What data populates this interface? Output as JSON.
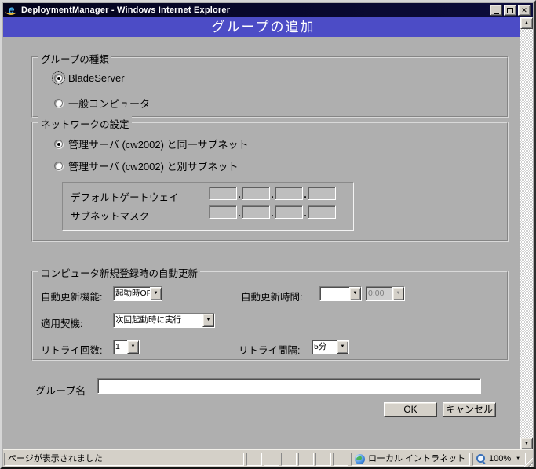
{
  "window": {
    "title": "DeploymentManager - Windows Internet Explorer",
    "header": "グループの追加"
  },
  "icons": {
    "close": "✕",
    "scroll_up": "▲",
    "scroll_down": "▼",
    "combo_arrow": "▼",
    "zoom_caret": "▼",
    "ip_dot": ".",
    "magnifier_plus": "+"
  },
  "group_type": {
    "legend": "グループの種類",
    "options": [
      {
        "label": "BladeServer",
        "selected": true
      },
      {
        "label": "一般コンピュータ",
        "selected": false
      }
    ]
  },
  "network": {
    "legend": "ネットワークの設定",
    "options": [
      {
        "label": "管理サーバ (cw2002) と同一サブネット",
        "selected": true
      },
      {
        "label": "管理サーバ (cw2002) と別サブネット",
        "selected": false
      }
    ],
    "gateway_label": "デフォルトゲートウェイ",
    "subnet_label": "サブネットマスク",
    "gateway_octets": [
      "",
      "",
      "",
      ""
    ],
    "subnet_octets": [
      "",
      "",
      "",
      ""
    ]
  },
  "auto_update": {
    "legend": "コンピュータ新規登録時の自動更新",
    "function_label": "自動更新機能:",
    "function_value": "起動時OFF",
    "time_label": "自動更新時間:",
    "time_value": "",
    "time_clock_value": "0:00",
    "trigger_label": "適用契機:",
    "trigger_value": "次回起動時に実行",
    "retry_count_label": "リトライ回数:",
    "retry_count_value": "1",
    "retry_interval_label": "リトライ間隔:",
    "retry_interval_value": "5分"
  },
  "group_name": {
    "label": "グループ名",
    "value": ""
  },
  "actions": {
    "ok": "OK",
    "cancel": "キャンセル"
  },
  "status_bar": {
    "message": "ページが表示されました",
    "zone": "ローカル イントラネット",
    "zoom_level": "100%"
  },
  "colors": {
    "header_bg": "#4c4cc6",
    "titlebar_bg": "#07072a",
    "page_bg": "#afafaf",
    "chrome_gray": "#d4d0c8"
  }
}
